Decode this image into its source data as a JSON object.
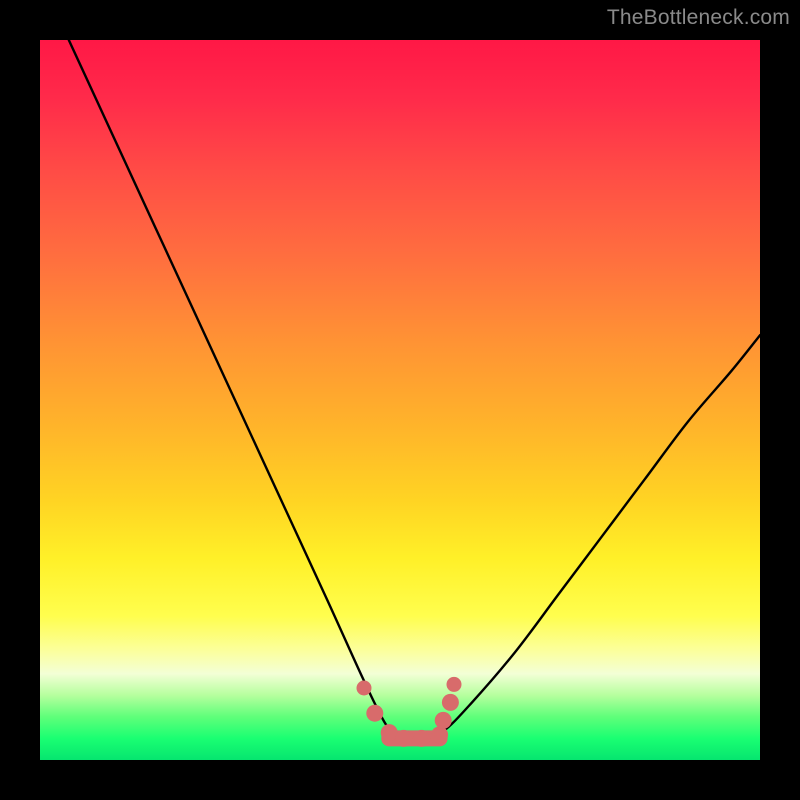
{
  "watermark": "TheBottleneck.com",
  "chart_data": {
    "type": "line",
    "title": "",
    "xlabel": "",
    "ylabel": "",
    "xlim": [
      0,
      100
    ],
    "ylim": [
      0,
      100
    ],
    "series": [
      {
        "name": "bottleneck-curve",
        "x": [
          4,
          10,
          16,
          22,
          28,
          34,
          40,
          45,
          48,
          50,
          53,
          56,
          60,
          66,
          72,
          78,
          84,
          90,
          96,
          100
        ],
        "values": [
          100,
          87,
          74,
          61,
          48,
          35,
          22,
          11,
          5,
          3,
          3,
          4,
          8,
          15,
          23,
          31,
          39,
          47,
          54,
          59
        ]
      }
    ],
    "markers": {
      "name": "highlight-points",
      "color": "#d86b6b",
      "x": [
        45,
        46.5,
        48.5,
        50.5,
        53,
        55.5,
        56,
        57,
        57.5
      ],
      "values": [
        10,
        6.5,
        3.8,
        3,
        3,
        3.5,
        5.5,
        8,
        10.5
      ]
    },
    "gradient_stops": [
      {
        "pos": 0,
        "color": "#ff1846"
      },
      {
        "pos": 30,
        "color": "#ff6e3f"
      },
      {
        "pos": 64,
        "color": "#ffd423"
      },
      {
        "pos": 85,
        "color": "#fbffa0"
      },
      {
        "pos": 100,
        "color": "#06e56f"
      }
    ]
  }
}
